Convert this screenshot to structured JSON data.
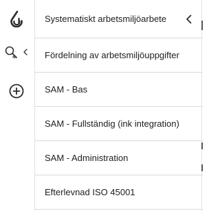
{
  "rail": {
    "items": [
      {
        "icon": "app-logo-icon"
      },
      {
        "icon": "search-icon"
      },
      {
        "icon": "add-circle-icon"
      }
    ]
  },
  "panel": {
    "title": "Systematiskt arbetsmiljöarbete",
    "collapse_icon": "chevron-left-icon",
    "items": [
      {
        "label": "Fördelning av arbetsmiljöuppgifter"
      },
      {
        "label": "SAM - Bas"
      },
      {
        "label": "SAM - Fullständig (ink integration)"
      },
      {
        "label": "SAM - Administration"
      },
      {
        "label": "Efterlevnad ISO 45001"
      }
    ]
  },
  "colors": {
    "text": "#202020",
    "divider": "#d9d9d9",
    "icon": "#333333",
    "background": "#ffffff"
  }
}
